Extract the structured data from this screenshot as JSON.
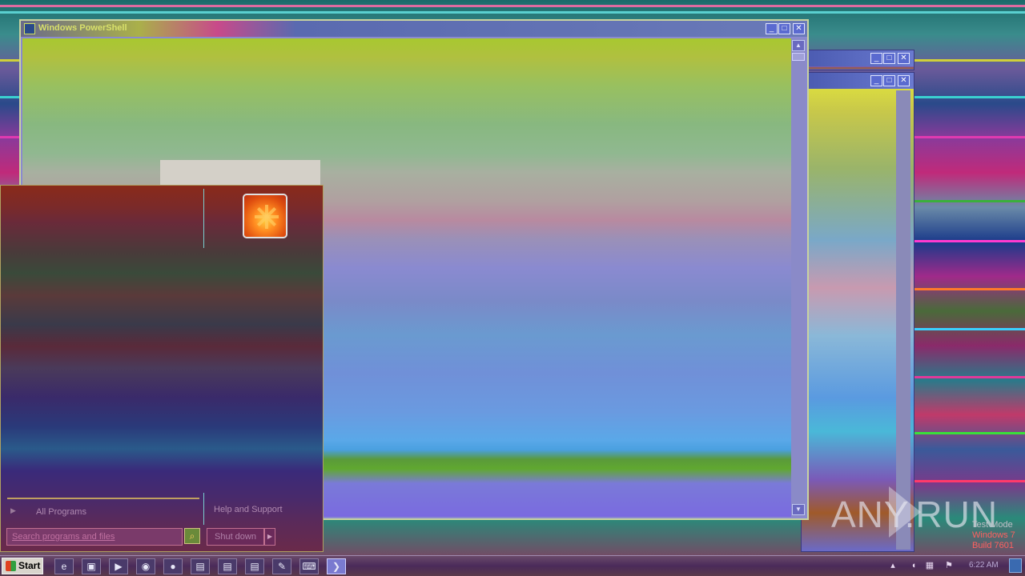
{
  "colors": {
    "titlebar_text": "#d8e06a",
    "start_menu_border": "#b0a060",
    "taskbar_bg": "#4a2a5a",
    "watermark": "#e6e6f0",
    "test_mode_red": "#ff6060"
  },
  "powershell_window": {
    "title": "Windows PowerShell",
    "icon": "powershell-icon",
    "controls": [
      "minimize-icon",
      "maximize-icon",
      "close-icon"
    ]
  },
  "background_windows": [
    {
      "controls": [
        "minimize-icon",
        "maximize-icon",
        "close-icon"
      ]
    },
    {
      "controls": [
        "minimize-icon",
        "maximize-icon",
        "close-icon"
      ]
    }
  ],
  "start_menu": {
    "user_picture": "flower-user-icon",
    "all_programs": "All Programs",
    "help_and_support": "Help and Support",
    "search_placeholder": "Search programs and files",
    "shutdown": "Shut down"
  },
  "watermark": {
    "text": "ANY.RUN",
    "test_mode_line1": "Test Mode",
    "test_mode_line2": "Windows 7",
    "test_mode_line3": "Build 7601"
  },
  "taskbar": {
    "start_label": "Start",
    "buttons": [
      {
        "icon": "internet-explorer-icon",
        "glyph": "e"
      },
      {
        "icon": "media-player-icon",
        "glyph": "▣"
      },
      {
        "icon": "media-center-icon",
        "glyph": "▶"
      },
      {
        "icon": "chrome-icon",
        "glyph": "◉"
      },
      {
        "icon": "firefox-icon",
        "glyph": "●"
      },
      {
        "icon": "document-icon",
        "glyph": "▤"
      },
      {
        "icon": "document-icon",
        "glyph": "▤"
      },
      {
        "icon": "document-icon",
        "glyph": "▤"
      },
      {
        "icon": "notepad-icon",
        "glyph": "✎"
      },
      {
        "icon": "terminal-icon",
        "glyph": "⌨"
      },
      {
        "icon": "powershell-icon",
        "glyph": "❯"
      }
    ],
    "tray_icons": [
      "arrow-up-icon",
      "volume-icon",
      "network-icon",
      "flag-icon"
    ],
    "clock": "6:22 AM"
  }
}
